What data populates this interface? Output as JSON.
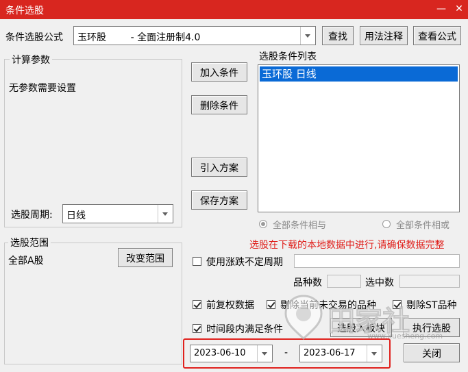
{
  "window": {
    "title": "条件选股",
    "minimize_icon": "—",
    "close_icon": "✕"
  },
  "formula": {
    "label": "条件选股公式",
    "value": "玉环股        - 全面注册制4.0",
    "find_label": "查找",
    "usage_label": "用法注释",
    "view_label": "查看公式"
  },
  "params": {
    "title": "计算参数",
    "text": "无参数需要设置",
    "period_label": "选股周期:",
    "period_value": "日线"
  },
  "actions": {
    "add": "加入条件",
    "remove": "删除条件",
    "import": "引入方案",
    "save": "保存方案"
  },
  "conditions": {
    "title": "选股条件列表",
    "items": [
      "玉环股  日线"
    ]
  },
  "logic": {
    "and_label": "全部条件相与",
    "or_label": "全部条件相或",
    "selected": "and"
  },
  "notice": "选股在下载的本地数据中进行,请确保数据完整",
  "scope": {
    "title": "选股范围",
    "value": "全部A股",
    "change_label": "改变范围"
  },
  "options": {
    "variable_period_label": "使用涨跌不定周期",
    "variable_period_checked": false,
    "count_label": "品种数",
    "selected_label": "选中数",
    "adjust_label": "前复权数据",
    "adjust_checked": true,
    "exclude_untraded_label": "剔除当前未交易的品种",
    "exclude_untraded_checked": true,
    "exclude_st_label": "剔除ST品种",
    "exclude_st_checked": true,
    "time_range_label": "时间段内满足条件",
    "time_range_checked": true
  },
  "buttons": {
    "to_block": "选股入板块",
    "run": "执行选股",
    "close": "关闭"
  },
  "dates": {
    "start": "2023-06-10",
    "separator": "-",
    "end": "2023-06-17"
  },
  "watermark": {
    "text": "田家社",
    "url": "www.xuesheng.com"
  },
  "colors": {
    "title_bar": "#d8261f",
    "selection": "#0a6ad6",
    "notice": "#e0201c",
    "highlight_box": "#e0201c"
  }
}
